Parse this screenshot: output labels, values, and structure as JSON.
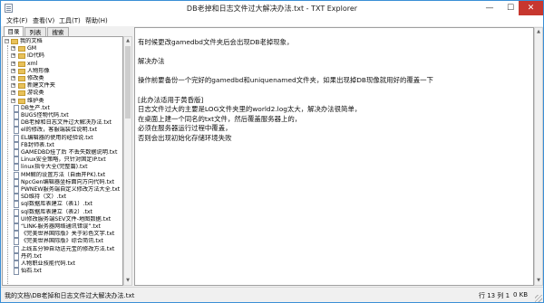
{
  "window": {
    "title": "DB老掉和日志文件过大解决办法.txt - TXT Explorer",
    "controls": {
      "minimize": "—",
      "maximize": "☐",
      "close": "✕"
    }
  },
  "menu": [
    "文件(F)",
    "查看(V)",
    "工具(T)",
    "帮助(H)"
  ],
  "tabs": [
    "目录",
    "列表",
    "搜索"
  ],
  "tree": {
    "root": "我的文档",
    "folders": [
      "GM",
      "ID代码",
      "xml",
      "人物形像",
      "修改类",
      "新建文件夹",
      "游说类",
      "维护类"
    ],
    "files": [
      "DB生产.txt",
      "BUGS怪物代码.txt",
      "DB老掉和日志文件过大解决办法.txt",
      "el的修改，客服端装位说明.txt",
      "EL编辑器的使用的经验说.txt",
      "FB封师表.txt",
      "GAMEDBD挂了后 不丢失数据说明.txt",
      "Linux安全策略，只针对固定IP.txt",
      "linux指令大全(完整篇).txt",
      "MM解的设置方法（自由开PK).txt",
      "NpcGen编辑器坐标面向方向代码.txt",
      "PWNEW服务端自定义修改方法大全.txt",
      "SD维持（文）.txt",
      "sql数据库表建立（表1）.txt",
      "sql数据库表建立（表2）.txt",
      "UI修改服务端SEV文件-地图数据.txt",
      "“LINK-服务器网络通讯错误”.txt",
      "《完美世界国际版》关于彩色文字.txt",
      "《完美世界国际版》综合简讯.txt",
      "上线五分钟自动送元宝的修改方法.txt",
      "丹药.txt",
      "人物职业技能代码.txt",
      "仙石.txt"
    ]
  },
  "content": {
    "lines": [
      "有时候更改gamedbd文件夹后会出现DB老掉现象，",
      "",
      "解决办法",
      "",
      "操作前要备份一个完好的gamedbd和uniquenamed文件夹，如果出现掉DB现像就用好的覆盖一下",
      "",
      "[此办法适用于黄昏版]",
      "日志文件过大的主要是LOG文件夹里的world2.log太大，解决办法很简单，",
      "在桌面上建一个同名的txt文件，然后覆盖服务器上的，",
      "必须在服务器运行过程中覆盖，",
      "否则会出现初始化存储环境失败"
    ]
  },
  "status": {
    "path": "我的文档\\DB老掉和日志文件过大解决办法.txt",
    "lines": "行 13 列 1",
    "size": "0 KB"
  }
}
